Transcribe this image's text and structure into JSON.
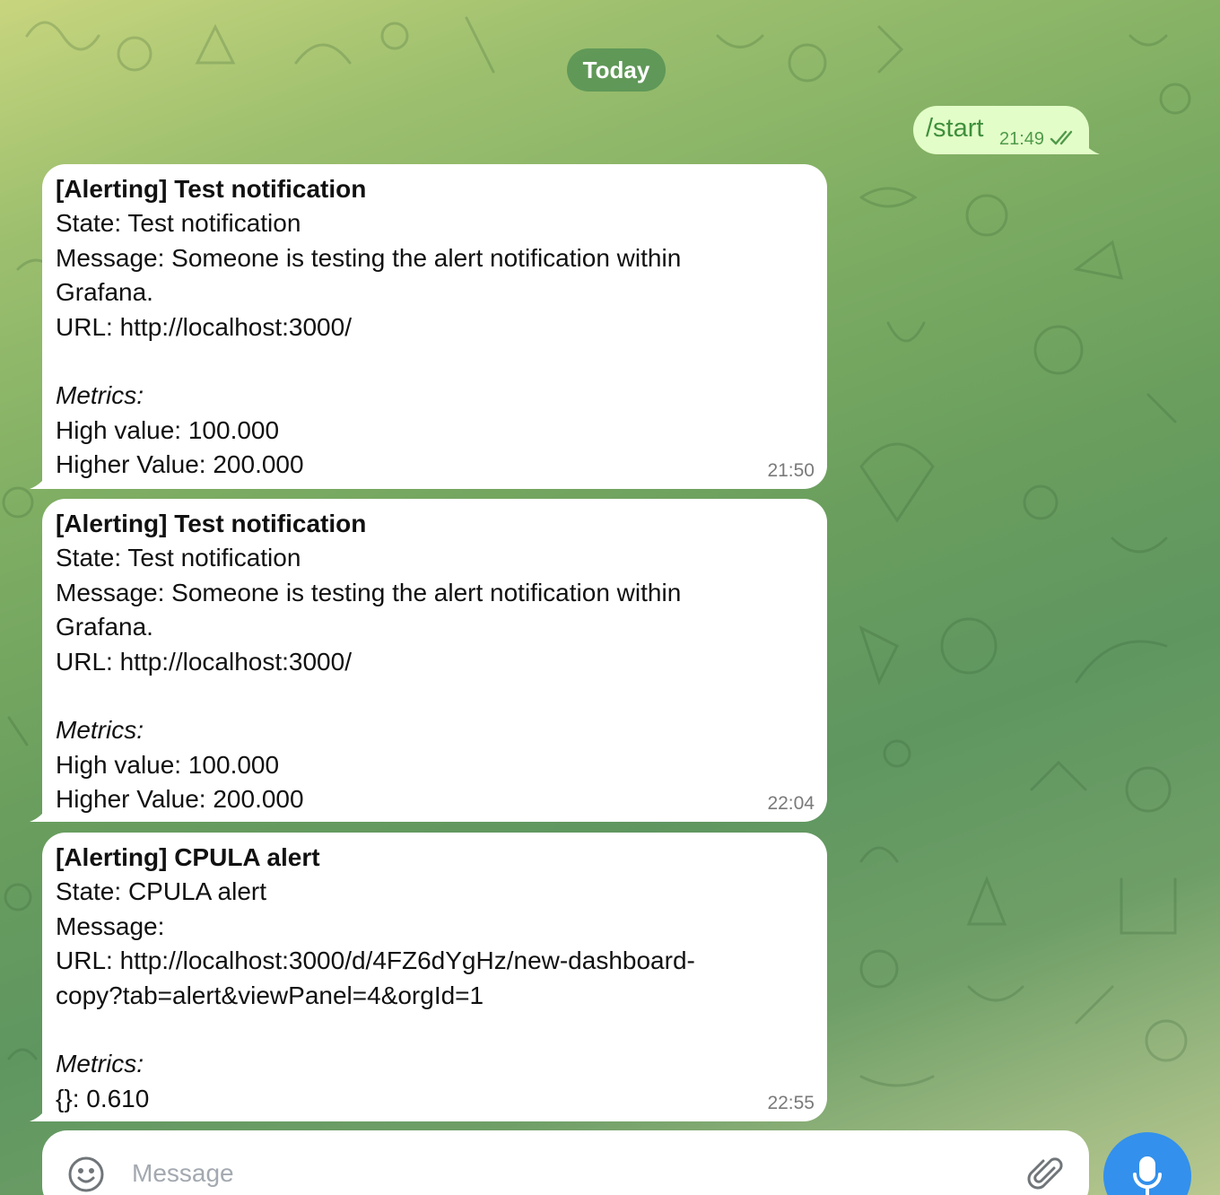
{
  "date_separator": "Today",
  "outgoing": {
    "text": "/start",
    "time": "21:49",
    "status_icon": "double-check-icon"
  },
  "incoming": [
    {
      "lines": [
        {
          "text": "[Alerting] Test notification",
          "style": "bold"
        },
        {
          "text": "State: Test notification",
          "style": "normal"
        },
        {
          "text": "Message: Someone is testing the alert notification within",
          "style": "normal"
        },
        {
          "text": "Grafana.",
          "style": "normal"
        },
        {
          "text": "URL: http://localhost:3000/",
          "style": "normal"
        },
        {
          "text": "",
          "style": "blank"
        },
        {
          "text": "Metrics:",
          "style": "italic"
        },
        {
          "text": "High value: 100.000",
          "style": "normal"
        },
        {
          "text": "Higher Value: 200.000",
          "style": "normal"
        }
      ],
      "time": "21:50"
    },
    {
      "lines": [
        {
          "text": "[Alerting] Test notification",
          "style": "bold"
        },
        {
          "text": "State: Test notification",
          "style": "normal"
        },
        {
          "text": "Message: Someone is testing the alert notification within",
          "style": "normal"
        },
        {
          "text": "Grafana.",
          "style": "normal"
        },
        {
          "text": "URL: http://localhost:3000/",
          "style": "normal"
        },
        {
          "text": "",
          "style": "blank"
        },
        {
          "text": "Metrics:",
          "style": "italic"
        },
        {
          "text": "High value: 100.000",
          "style": "normal"
        },
        {
          "text": "Higher Value: 200.000",
          "style": "normal"
        }
      ],
      "time": "22:04"
    },
    {
      "lines": [
        {
          "text": "[Alerting] CPULA alert",
          "style": "bold"
        },
        {
          "text": "State: CPULA alert",
          "style": "normal"
        },
        {
          "text": "Message:",
          "style": "normal"
        },
        {
          "text": "URL: http://localhost:3000/d/4FZ6dYgHz/new-dashboard-",
          "style": "normal"
        },
        {
          "text": "copy?tab=alert&viewPanel=4&orgId=1",
          "style": "normal"
        },
        {
          "text": "",
          "style": "blank"
        },
        {
          "text": "Metrics:",
          "style": "italic"
        },
        {
          "text": "{}: 0.610",
          "style": "normal"
        }
      ],
      "time": "22:55"
    }
  ],
  "composer": {
    "placeholder": "Message",
    "emoji_icon": "smiley-icon",
    "attach_icon": "paperclip-icon",
    "send_icon": "microphone-icon"
  },
  "colors": {
    "outgoing_bubble": "#e3fdc8",
    "incoming_bubble": "#ffffff",
    "accent": "#3390ec",
    "date_pill": "#4e8c52"
  }
}
